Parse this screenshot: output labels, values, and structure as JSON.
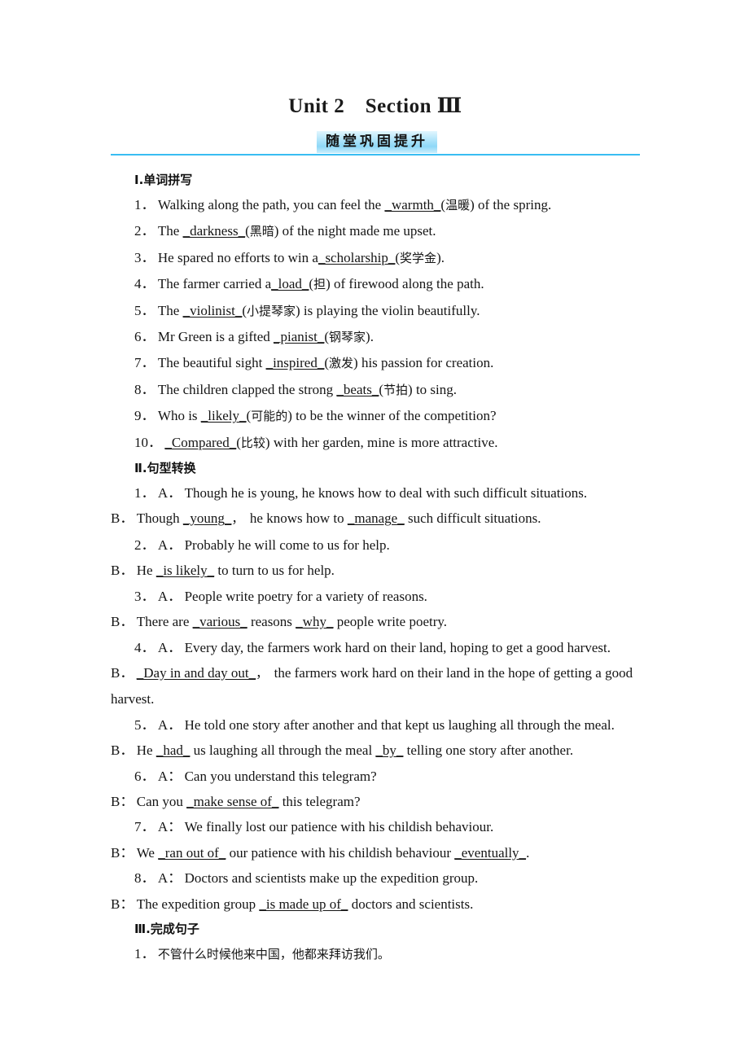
{
  "document": {
    "title": "Unit 2　Section Ⅲ",
    "banner_label": "随堂巩固提升",
    "accent_color": "#39bdf2",
    "banner_gradient_light": "#e2f6fe",
    "banner_gradient_dark": "#8ed8f7"
  },
  "sections": [
    {
      "heading": "Ⅰ.单词拼写",
      "items": [
        {
          "num": "1．",
          "text": "Walking along the path, you can feel the __warmth__(温暖) of the spring."
        },
        {
          "num": "2．",
          "text": "The __darkness__(黑暗) of the night made me upset."
        },
        {
          "num": "3．",
          "text": "He spared no efforts to win a__scholarship__(奖学金)."
        },
        {
          "num": "4．",
          "text": "The farmer carried a__load__(担) of firewood along the path."
        },
        {
          "num": "5．",
          "text": "The __violinist__(小提琴家) is playing the violin beautifully."
        },
        {
          "num": "6．",
          "text": "Mr Green is a gifted __pianist__(钢琴家)."
        },
        {
          "num": "7．",
          "text": "The beautiful sight __inspired__(激发) his passion for creation."
        },
        {
          "num": "8．",
          "text": "The children clapped the strong __beats__(节拍) to sing."
        },
        {
          "num": "9．",
          "text": "Who is __likely__(可能的) to be the winner of the competition?"
        },
        {
          "num": "10．",
          "text": "__Compared__(比较) with her garden, mine is more attractive."
        }
      ]
    },
    {
      "heading": "Ⅱ.句型转换",
      "items": [
        {
          "num": "1．",
          "label": "A．",
          "text": "Though he is young, he knows how to deal with such difficult situations."
        },
        {
          "num": "",
          "label": "B．",
          "text": "Though __young__，　he knows how to __manage__ such difficult situations."
        },
        {
          "num": "2．",
          "label": "A．",
          "text": "Probably he will come to us for help."
        },
        {
          "num": "",
          "label": "B．",
          "text": "He __is likely__ to turn to us for help."
        },
        {
          "num": "3．",
          "label": "A．",
          "text": "People write poetry for a variety of reasons."
        },
        {
          "num": "",
          "label": "B．",
          "text": "There are __various__ reasons __why__ people write poetry."
        },
        {
          "num": "4．",
          "label": "A．",
          "text": "Every day, the farmers work hard on their land, hoping to get a good harvest."
        },
        {
          "num": "",
          "label": "B．",
          "text": "__Day in and day out__，　the farmers work hard on their land in the hope of getting a good harvest."
        },
        {
          "num": "5．",
          "label": "A．",
          "text": "He told one story after another and that kept us laughing all through the meal."
        },
        {
          "num": "",
          "label": "B．",
          "text": "He __had__ us laughing all through the meal __by__ telling one story after another."
        },
        {
          "num": "6．",
          "label": "A：",
          "text": "Can you understand this telegram?"
        },
        {
          "num": "",
          "label": "B：",
          "text": "Can you __make sense of__ this telegram?"
        },
        {
          "num": "7．",
          "label": "A：",
          "text": "We finally lost our patience with his childish behaviour."
        },
        {
          "num": "",
          "label": "B：",
          "text": "We __ran out of__ our patience with his childish behaviour __eventually__."
        },
        {
          "num": "8．",
          "label": "A：",
          "text": "Doctors and scientists make up the expedition group."
        },
        {
          "num": "",
          "label": "B：",
          "text": "The expedition group __is made up of__ doctors and scientists."
        }
      ]
    },
    {
      "heading": "Ⅲ.完成句子",
      "items": [
        {
          "num": "1．",
          "text": "不管什么时候他来中国，他都来拜访我们。"
        }
      ]
    }
  ]
}
